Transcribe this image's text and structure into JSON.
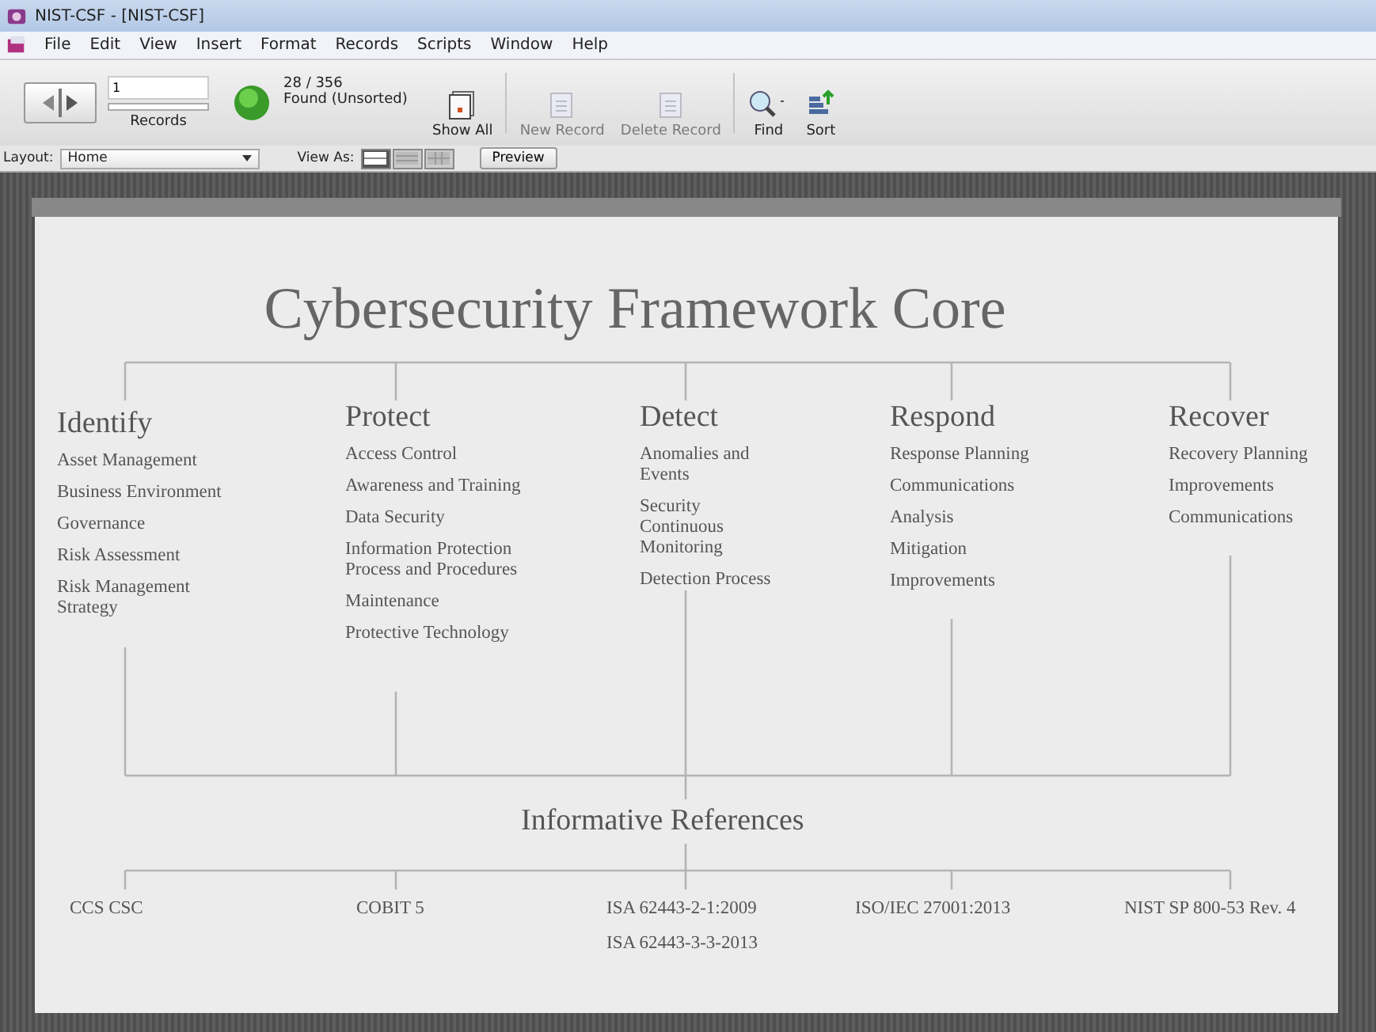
{
  "window": {
    "title": "NIST-CSF - [NIST-CSF]"
  },
  "menu": [
    "File",
    "Edit",
    "View",
    "Insert",
    "Format",
    "Records",
    "Scripts",
    "Window",
    "Help"
  ],
  "toolbar": {
    "record_number": "1",
    "records_label": "Records",
    "found_count": "28 / 356",
    "found_status": "Found (Unsorted)",
    "buttons": [
      {
        "label": "Show All",
        "disabled": false,
        "kind": "showall"
      },
      {
        "label": "New Record",
        "disabled": true,
        "kind": "new"
      },
      {
        "label": "Delete Record",
        "disabled": true,
        "kind": "delete"
      },
      {
        "label": "Find",
        "disabled": false,
        "kind": "find"
      },
      {
        "label": "Sort",
        "disabled": false,
        "kind": "sort"
      }
    ]
  },
  "layout_bar": {
    "layout_label": "Layout:",
    "layout_value": "Home",
    "view_as_label": "View As:",
    "view_modes": [
      {
        "kind": "form",
        "selected": true
      },
      {
        "kind": "list",
        "selected": false
      },
      {
        "kind": "table",
        "selected": false
      }
    ],
    "preview": "Preview"
  },
  "diagram": {
    "title": "Cybersecurity Framework Core",
    "functions": [
      {
        "heading": "Identify",
        "items": [
          "Asset Management",
          "Business Environment",
          "Governance",
          "Risk Assessment",
          "Risk Management Strategy"
        ]
      },
      {
        "heading": "Protect",
        "items": [
          "Access Control",
          "Awareness and Training",
          "Data Security",
          "Information Protection Process and Procedures",
          "Maintenance",
          "Protective Technology"
        ]
      },
      {
        "heading": "Detect",
        "items": [
          "Anomalies and Events",
          "Security Continuous Monitoring",
          "Detection Process"
        ]
      },
      {
        "heading": "Respond",
        "items": [
          "Response Planning",
          "Communications",
          "Analysis",
          "Mitigation",
          "Improvements"
        ]
      },
      {
        "heading": "Recover",
        "items": [
          "Recovery Planning",
          "Improvements",
          "Communications"
        ]
      }
    ],
    "references_title": "Informative References",
    "references": [
      [
        "CCS CSC"
      ],
      [
        "COBIT 5"
      ],
      [
        "ISA 62443-2-1:2009",
        "ISA 62443-3-3-2013"
      ],
      [
        "ISO/IEC 27001:2013"
      ],
      [
        "NIST SP 800-53 Rev. 4"
      ]
    ]
  }
}
